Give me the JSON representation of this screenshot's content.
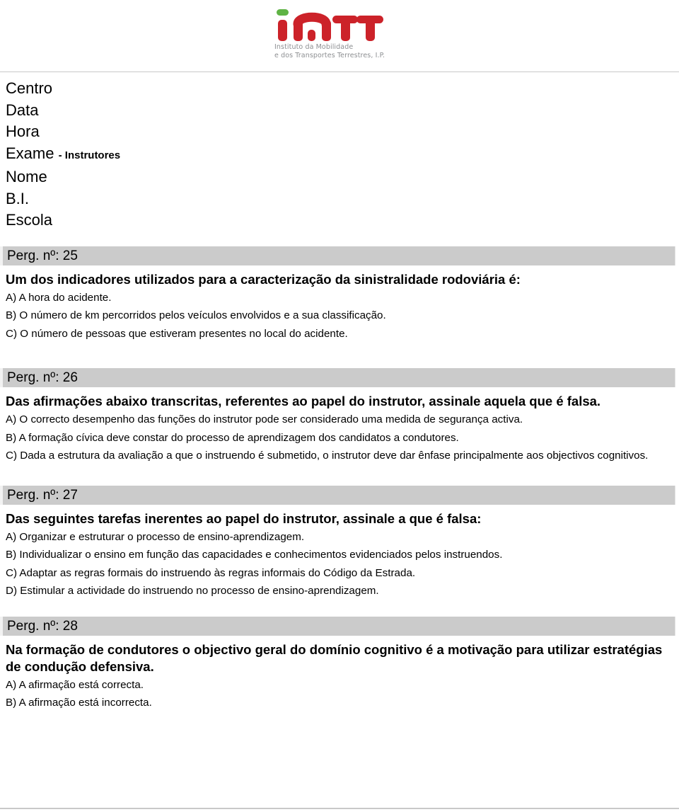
{
  "logo": {
    "wordmark": "imtt",
    "subtitle": "Instituto da Mobilidade\ne dos Transportes Terrestres, I.P.",
    "colors": {
      "letter_red": "#cc2229",
      "dot_green": "#5fb345",
      "subtitle_gray": "#8d8f92"
    }
  },
  "meta": {
    "centro": "Centro",
    "data": "Data",
    "hora": "Hora",
    "exame": "Exame",
    "exame_suffix": "- Instrutores",
    "nome": "Nome",
    "bi": "B.I.",
    "escola": "Escola"
  },
  "questions": [
    {
      "header": "Perg. nº: 25",
      "text": "Um dos indicadores utilizados para a caracterização da sinistralidade rodoviária é:",
      "options": [
        "A) A hora do acidente.",
        "B) O número de km percorridos pelos veículos envolvidos e a sua classificação.",
        "C) O número de pessoas que estiveram presentes no local do acidente."
      ]
    },
    {
      "header": "Perg. nº: 26",
      "text": "Das afirmações abaixo transcritas, referentes ao papel do instrutor, assinale aquela que é falsa.",
      "options": [
        "A) O correcto desempenho das funções do instrutor pode ser considerado uma medida de segurança activa.",
        "B) A formação cívica deve constar do processo de aprendizagem dos candidatos a condutores.",
        "C) Dada a estrutura da avaliação a que o instruendo é submetido, o instrutor deve dar ênfase principalmente aos objectivos cognitivos."
      ]
    },
    {
      "header": "Perg. nº: 27",
      "text": "Das seguintes tarefas inerentes ao papel do instrutor, assinale a que é falsa:",
      "options": [
        "A) Organizar e estruturar o processo de ensino-aprendizagem.",
        "B) Individualizar o ensino em função das capacidades e conhecimentos evidenciados pelos instruendos.",
        "C) Adaptar as regras formais do instruendo às regras informais do Código da Estrada.",
        "D) Estimular a actividade do instruendo no processo de ensino-aprendizagem."
      ]
    },
    {
      "header": "Perg. nº: 28",
      "text": "Na formação de condutores o objectivo geral do domínio cognitivo é a motivação para utilizar estratégias de condução defensiva.",
      "options": [
        "A) A afirmação está correcta.",
        "B) A afirmação está incorrecta."
      ]
    }
  ]
}
